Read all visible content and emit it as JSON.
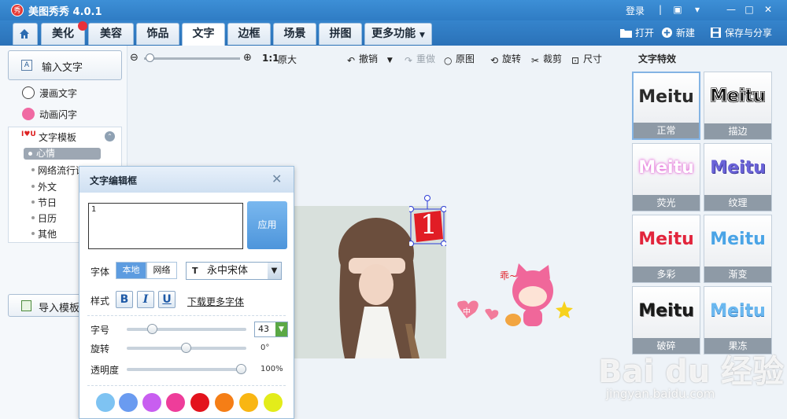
{
  "app": {
    "title": "美图秀秀 4.0.1",
    "logo_text": "秀",
    "login": "登录"
  },
  "tabs": [
    {
      "label": "美化"
    },
    {
      "label": "美容"
    },
    {
      "label": "饰品"
    },
    {
      "label": "文字"
    },
    {
      "label": "边框"
    },
    {
      "label": "场景"
    },
    {
      "label": "拼图"
    },
    {
      "label": "更多功能"
    }
  ],
  "active_tab": "文字",
  "top_actions": {
    "open": "打开",
    "new": "新建",
    "save_share": "保存与分享"
  },
  "left": {
    "input_text": "输入文字",
    "input_text_icon": "A",
    "comic_text": "漫画文字",
    "anim_text": "动画闪字",
    "template": "文字模板",
    "template_items": [
      "心情",
      "网络流行语",
      "外文",
      "节日",
      "日历",
      "其他"
    ],
    "selected_item": "心情",
    "import_template": "导入模板"
  },
  "toolbar": {
    "zoom_ratio": "1:1",
    "original_size": "原大",
    "undo": "撤销",
    "redo": "重做",
    "original": "原图",
    "rotate": "旋转",
    "crop": "裁剪",
    "size": "尺寸"
  },
  "canvas": {
    "text_sticker": "1",
    "badge_text": "中"
  },
  "dialog": {
    "title": "文字编辑框",
    "text_value": "1",
    "apply": "应用",
    "font_label": "字体",
    "local": "本地",
    "network": "网络",
    "font_name": "永中宋体",
    "style_label": "样式",
    "bold": "B",
    "italic": "I",
    "underline": "U",
    "download_fonts": "下载更多字体",
    "size_label": "字号",
    "size_value": "43",
    "rotate_label": "旋转",
    "rotate_value": "0°",
    "opacity_label": "透明度",
    "opacity_value": "100%",
    "swatches": [
      "#7ec3f2",
      "#6a9bf0",
      "#c85ef0",
      "#ee3d9a",
      "#e3131d",
      "#f57e16",
      "#f9b613",
      "#e3ec1a"
    ]
  },
  "effects": {
    "title": "文字特效",
    "items": [
      {
        "sample": "Meitu",
        "label": "正常"
      },
      {
        "sample": "Meitu",
        "label": "描边"
      },
      {
        "sample": "Meitu",
        "label": "荧光"
      },
      {
        "sample": "Meitu",
        "label": "纹理"
      },
      {
        "sample": "Meitu",
        "label": "多彩"
      },
      {
        "sample": "Meitu",
        "label": "渐变"
      },
      {
        "sample": "Meitu",
        "label": "破碎"
      },
      {
        "sample": "Meitu",
        "label": "果冻"
      }
    ]
  },
  "watermark": {
    "text": "Bai du 经验",
    "url": "jingyan.baidu.com"
  }
}
